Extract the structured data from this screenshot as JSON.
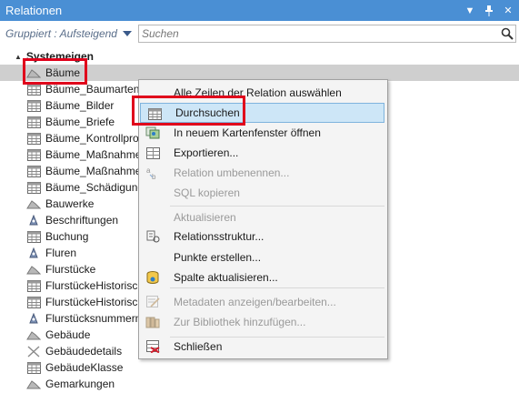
{
  "panel": {
    "title": "Relationen"
  },
  "toolbar": {
    "grouping_label": "Gruppiert : Aufsteigend",
    "search_placeholder": "Suchen"
  },
  "tree": {
    "group_label": "Systemeigen",
    "items": [
      {
        "label": "Bäume",
        "icon": "polygon-layer-icon"
      },
      {
        "label": "Bäume_Baumarten",
        "icon": "table-icon"
      },
      {
        "label": "Bäume_Bilder",
        "icon": "table-icon"
      },
      {
        "label": "Bäume_Briefe",
        "icon": "table-icon"
      },
      {
        "label": "Bäume_Kontrollpro",
        "icon": "table-icon"
      },
      {
        "label": "Bäume_Maßnahme",
        "icon": "table-icon"
      },
      {
        "label": "Bäume_Maßnahme",
        "icon": "table-icon"
      },
      {
        "label": "Bäume_Schädigung",
        "icon": "table-icon"
      },
      {
        "label": "Bauwerke",
        "icon": "polygon-layer-icon"
      },
      {
        "label": "Beschriftungen",
        "icon": "label-layer-icon"
      },
      {
        "label": "Buchung",
        "icon": "table-icon"
      },
      {
        "label": "Fluren",
        "icon": "label-layer-icon"
      },
      {
        "label": "Flurstücke",
        "icon": "polygon-layer-icon"
      },
      {
        "label": "FlurstückeHistorisch",
        "icon": "table-icon"
      },
      {
        "label": "FlurstückeHistorisch",
        "icon": "table-icon"
      },
      {
        "label": "Flurstücksnummern",
        "icon": "label-layer-icon"
      },
      {
        "label": "Gebäude",
        "icon": "polygon-layer-icon"
      },
      {
        "label": "Gebäudedetails",
        "icon": "line-layer-icon"
      },
      {
        "label": "GebäudeKlasse",
        "icon": "table-icon"
      },
      {
        "label": "Gemarkungen",
        "icon": "polygon-layer-icon"
      }
    ]
  },
  "context_menu": {
    "items": [
      {
        "label": "Alle Zeilen der Relation auswählen",
        "icon": "",
        "enabled": true
      },
      {
        "label": "Durchsuchen",
        "icon": "browse-table-icon",
        "enabled": true,
        "active": true
      },
      {
        "label": "In neuem Kartenfenster öffnen",
        "icon": "map-window-icon",
        "enabled": true
      },
      {
        "label": "Exportieren...",
        "icon": "export-icon",
        "enabled": true
      },
      {
        "label": "Relation umbenennen...",
        "icon": "rename-icon",
        "enabled": false
      },
      {
        "label": "SQL kopieren",
        "icon": "",
        "enabled": false
      },
      {
        "label": "Aktualisieren",
        "icon": "",
        "enabled": false
      },
      {
        "label": "Relationsstruktur...",
        "icon": "structure-icon",
        "enabled": true
      },
      {
        "label": "Punkte erstellen...",
        "icon": "",
        "enabled": true
      },
      {
        "label": "Spalte aktualisieren...",
        "icon": "update-column-icon",
        "enabled": true
      },
      {
        "label": "Metadaten anzeigen/bearbeiten...",
        "icon": "metadata-icon",
        "enabled": false
      },
      {
        "label": "Zur Bibliothek hinzufügen...",
        "icon": "library-icon",
        "enabled": false
      },
      {
        "label": "Schließen",
        "icon": "close-table-icon",
        "enabled": true
      }
    ]
  }
}
